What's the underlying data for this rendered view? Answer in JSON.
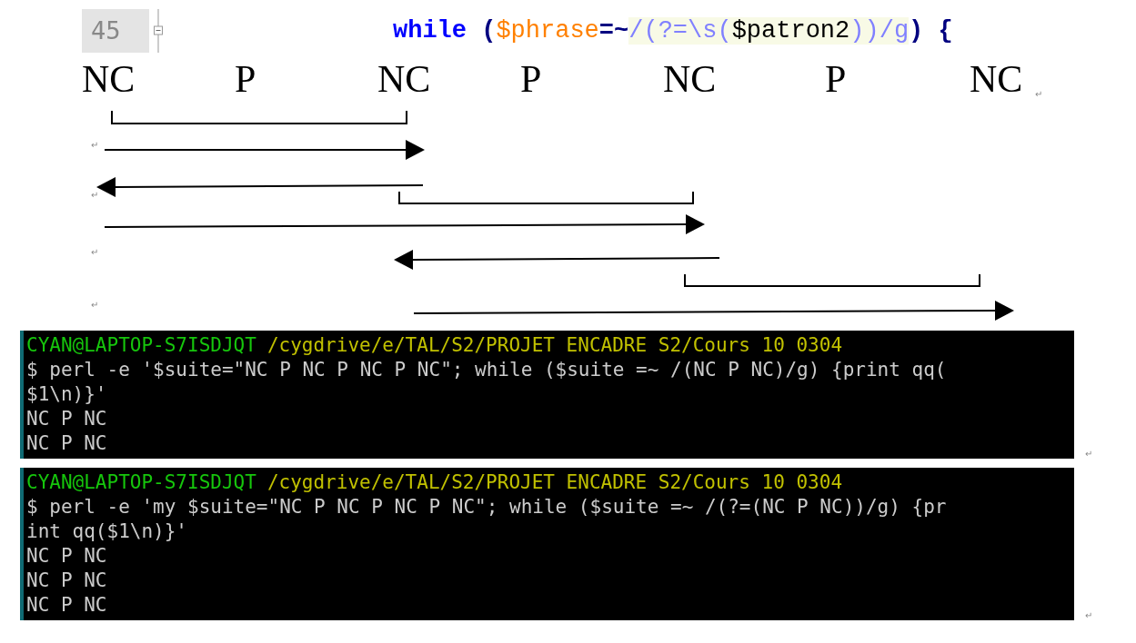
{
  "code_line": {
    "line_number": "45",
    "tokens": [
      {
        "text": "while",
        "kind": "keyword"
      },
      {
        "text": "(",
        "kind": "operator"
      },
      {
        "text": "$phrase",
        "kind": "variable"
      },
      {
        "text": "=~",
        "kind": "operator"
      },
      {
        "text": "/(?=\\s(",
        "kind": "regex"
      },
      {
        "text": "$patron2",
        "kind": "regex_var"
      },
      {
        "text": "))/g",
        "kind": "regex"
      },
      {
        "text": ")",
        "kind": "operator"
      },
      {
        "text": "{",
        "kind": "brace"
      }
    ]
  },
  "diagram": {
    "labels": [
      "NC",
      "P",
      "NC",
      "P",
      "NC",
      "P",
      "NC"
    ],
    "label_row_mark": "↵",
    "line_marks": [
      "↵",
      "↵",
      "↵",
      "↵"
    ]
  },
  "terminals": [
    {
      "lines": [
        {
          "kind": "prompt",
          "user": "CYAN@LAPTOP-S7ISDJQT",
          "path": "/cygdrive/e/TAL/S2/PROJET ENCADRE S2/Cours 10 0304"
        },
        {
          "kind": "output",
          "text": "$ perl -e '$suite=\"NC P NC P NC P NC\"; while ($suite =~ /(NC P NC)/g) {print qq("
        },
        {
          "kind": "output",
          "text": "$1\\n)}'"
        },
        {
          "kind": "output",
          "text": "NC P NC"
        },
        {
          "kind": "output",
          "text": "NC P NC"
        }
      ],
      "end_mark": "↵"
    },
    {
      "lines": [
        {
          "kind": "prompt",
          "user": "CYAN@LAPTOP-S7ISDJQT",
          "path": "/cygdrive/e/TAL/S2/PROJET ENCADRE S2/Cours 10 0304"
        },
        {
          "kind": "output",
          "text": "$ perl -e 'my $suite=\"NC P NC P NC P NC\"; while ($suite =~ /(?=(NC P NC))/g) {pr"
        },
        {
          "kind": "output",
          "text": "int qq($1\\n)}'"
        },
        {
          "kind": "output",
          "text": "NC P NC"
        },
        {
          "kind": "output",
          "text": "NC P NC"
        },
        {
          "kind": "output",
          "text": "NC P NC"
        }
      ],
      "end_mark": "↵"
    }
  ]
}
